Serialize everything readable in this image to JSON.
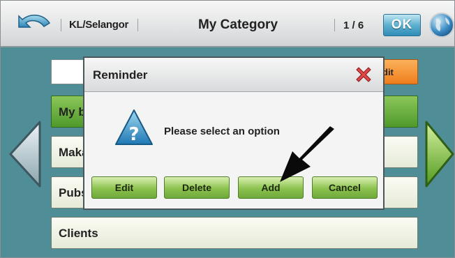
{
  "header": {
    "location": "KL/Selangor",
    "title": "My Category",
    "page_indicator": "1 / 6",
    "ok_label": "OK"
  },
  "list": {
    "top_action_label": "dit",
    "rows": [
      {
        "label": "My b",
        "selected": true
      },
      {
        "label": "Maka",
        "selected": false
      },
      {
        "label": "Pubs",
        "selected": false
      },
      {
        "label": "Clients",
        "selected": false
      }
    ]
  },
  "dialog": {
    "title": "Reminder",
    "message": "Please select an option",
    "buttons": {
      "edit": "Edit",
      "delete": "Delete",
      "add": "Add",
      "cancel": "Cancel"
    }
  },
  "colors": {
    "background": "#4f8e97",
    "selected_row": "#6aaa3a",
    "dialog_button": "#8cc24f",
    "ok_button": "#3d98c2",
    "close": "#d93a3a"
  },
  "icons": [
    "back-icon",
    "globe-icon",
    "left-arrow-icon",
    "right-arrow-icon",
    "close-icon",
    "question-icon",
    "pointer-arrow-icon"
  ]
}
